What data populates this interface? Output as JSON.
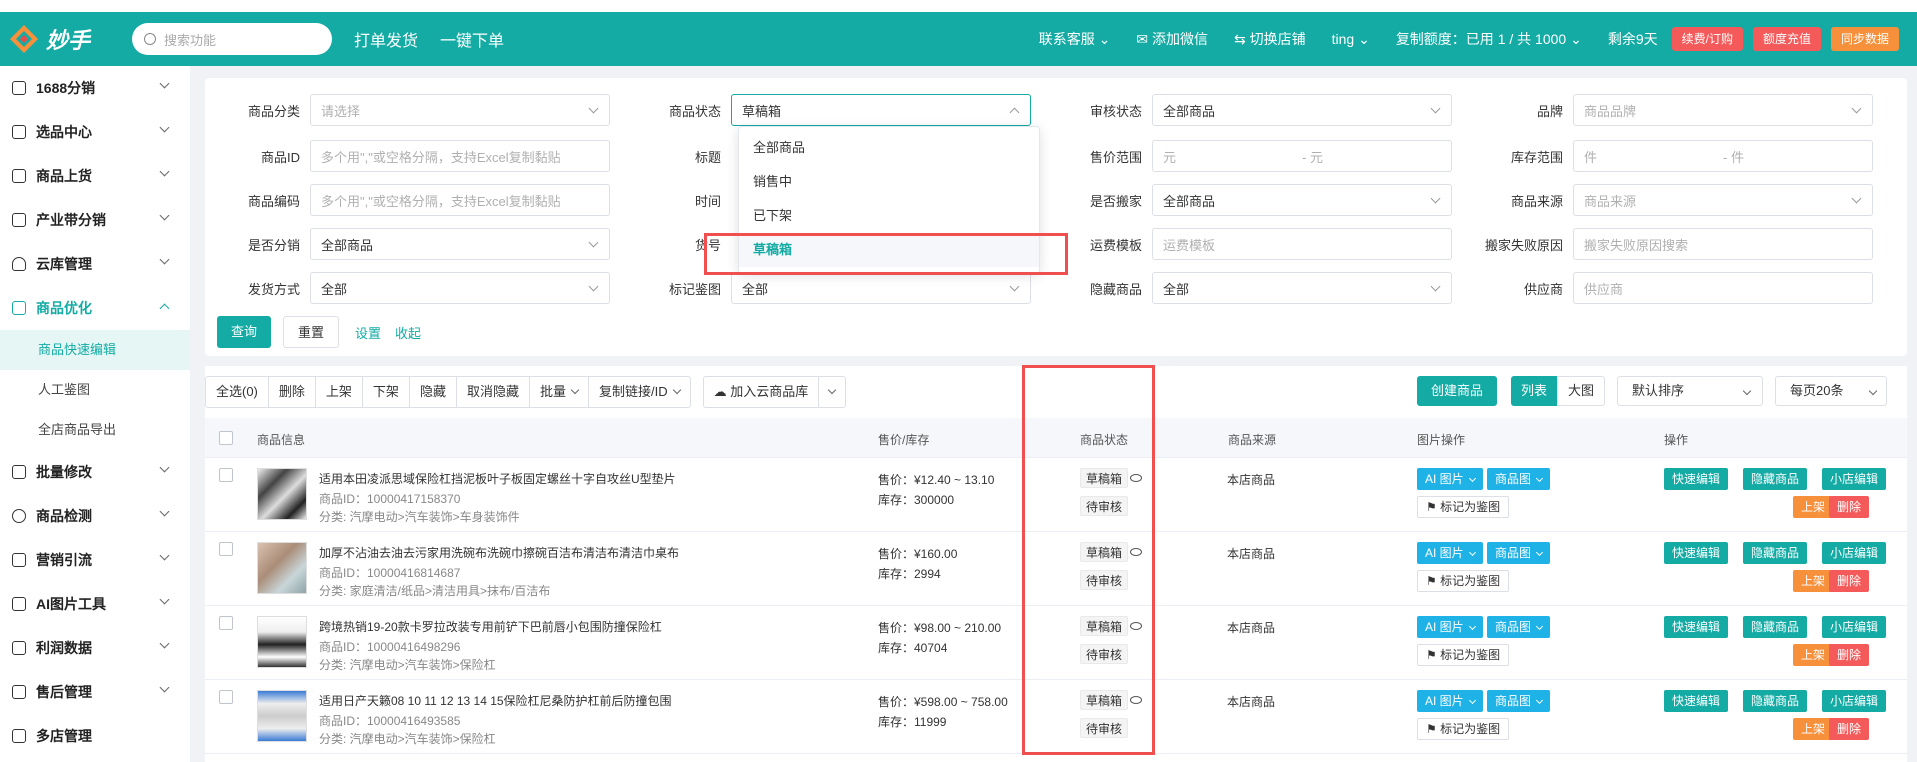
{
  "colors": {
    "primary": "#13aba4",
    "danger_box": "#ef4f4f",
    "blue": "#1fb2e6",
    "orange": "#f7903b",
    "red": "#f45a5a"
  },
  "header": {
    "logo_text": "妙手",
    "search_placeholder": "搜索功能",
    "links": [
      "打单发货",
      "一键下单"
    ],
    "contact": "联系客服",
    "wechat": "添加微信",
    "switch_store": "切换店铺",
    "user": "ting",
    "quota": "复制额度：已用 1 / 共 1000",
    "days_left": "剩余9天",
    "btn_renew": "续费/订购",
    "btn_recharge": "额度充值",
    "btn_sync": "同步数据"
  },
  "sidebar": {
    "items": [
      {
        "label": "1688分销"
      },
      {
        "label": "选品中心"
      },
      {
        "label": "商品上货"
      },
      {
        "label": "产业带分销"
      },
      {
        "label": "云库管理"
      },
      {
        "label": "商品优化"
      },
      {
        "label": "批量修改"
      },
      {
        "label": "商品检测"
      },
      {
        "label": "营销引流"
      },
      {
        "label": "AI图片工具"
      },
      {
        "label": "利润数据"
      },
      {
        "label": "售后管理"
      },
      {
        "label": "多店管理"
      }
    ],
    "subitems": [
      "商品快速编辑",
      "人工鉴图",
      "全店商品导出"
    ]
  },
  "filters": {
    "category": {
      "label": "商品分类",
      "placeholder": "请选择"
    },
    "status": {
      "label": "商品状态",
      "value": "草稿箱"
    },
    "audit": {
      "label": "审核状态",
      "value": "全部商品"
    },
    "brand": {
      "label": "品牌",
      "placeholder": "商品品牌"
    },
    "product_id": {
      "label": "商品ID",
      "placeholder": "多个用\",\"或空格分隔，支持Excel复制黏贴"
    },
    "title": {
      "label": "标题"
    },
    "price_range": {
      "label": "售价范围",
      "from": "元",
      "to": "- 元"
    },
    "stock_range": {
      "label": "库存范围",
      "from": "件",
      "to": "- 件"
    },
    "code": {
      "label": "商品编码",
      "placeholder": "多个用\",\"或空格分隔，支持Excel复制黏贴"
    },
    "time": {
      "label": "时间"
    },
    "moved": {
      "label": "是否搬家",
      "value": "全部商品"
    },
    "source": {
      "label": "商品来源",
      "placeholder": "商品来源"
    },
    "distributed": {
      "label": "是否分销",
      "value": "全部商品"
    },
    "huohao": {
      "label": "货号"
    },
    "shipping_tpl": {
      "label": "运费模板",
      "placeholder": "运费模板"
    },
    "fail_reason": {
      "label": "搬家失败原因",
      "placeholder": "搬家失败原因搜索"
    },
    "ship_method": {
      "label": "发货方式",
      "value": "全部"
    },
    "mark": {
      "label": "标记鉴图",
      "value": "全部"
    },
    "hidden": {
      "label": "隐藏商品",
      "value": "全部"
    },
    "supplier": {
      "label": "供应商",
      "placeholder": "供应商"
    },
    "btn_query": "查询",
    "btn_reset": "重置",
    "link_settings": "设置",
    "link_collapse": "收起",
    "status_options": [
      "全部商品",
      "销售中",
      "已下架",
      "草稿箱"
    ]
  },
  "toolbar": {
    "group": [
      "全选(0)",
      "删除",
      "上架",
      "下架",
      "隐藏",
      "取消隐藏",
      "批量",
      "复制链接/ID"
    ],
    "cloud": "加入云商品库",
    "create": "创建商品",
    "view_list": "列表",
    "view_big": "大图",
    "sort": "默认排序",
    "per_page": "每页20条"
  },
  "table": {
    "headers": [
      "商品信息",
      "售价/库存",
      "商品状态",
      "商品来源",
      "图片操作",
      "操作"
    ],
    "rows": [
      {
        "title": "适用本田凌派思域保险杠挡泥板叶子板固定螺丝十字自攻丝U型垫片",
        "id": "商品ID：10000417158370",
        "cat": "分类: 汽摩电动>汽车装饰>车身装饰件",
        "price": "售价：¥12.40 ~ 13.10",
        "stock": "库存：300000",
        "status": "草稿箱",
        "audit": "待审核",
        "source": "本店商品"
      },
      {
        "title": "加厚不沾油去油去污家用洗碗布洗碗巾擦碗百洁布清洁布清洁巾桌布",
        "id": "商品ID：10000416814687",
        "cat": "分类: 家庭清洁/纸品>清洁用具>抹布/百洁布",
        "price": "售价：¥160.00",
        "stock": "库存：2994",
        "status": "草稿箱",
        "audit": "待审核",
        "source": "本店商品"
      },
      {
        "title": "跨境热销19-20款卡罗拉改装专用前铲下巴前唇小包围防撞保险杠",
        "id": "商品ID：10000416498296",
        "cat": "分类: 汽摩电动>汽车装饰>保险杠",
        "price": "售价：¥98.00 ~ 210.00",
        "stock": "库存：40704",
        "status": "草稿箱",
        "audit": "待审核",
        "source": "本店商品"
      },
      {
        "title": "适用日产天籁08 10 11 12 13 14 15保险杠尼桑防护杠前后防撞包围",
        "id": "商品ID：10000416493585",
        "cat": "分类: 汽摩电动>汽车装饰>保险杠",
        "price": "售价：¥598.00 ~ 758.00",
        "stock": "库存：11999",
        "status": "草稿箱",
        "audit": "待审核",
        "source": "本店商品"
      }
    ],
    "img_ai": "AI 图片",
    "img_product": "商品图",
    "mark_btn": "标记为鉴图",
    "act_quick": "快速编辑",
    "act_hide": "隐藏商品",
    "act_shop": "小店编辑",
    "act_on": "上架",
    "act_del": "删除"
  }
}
